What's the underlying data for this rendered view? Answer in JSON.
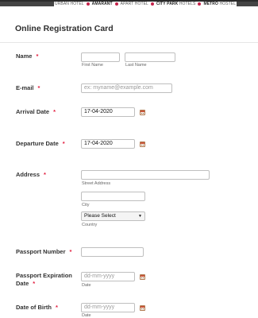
{
  "brand_bar": {
    "segments": [
      {
        "light": "URBAN HOTEL",
        "bold": ""
      },
      {
        "light": "",
        "bold": "AMARANT"
      },
      {
        "light": "APART HOTEL",
        "bold": ""
      },
      {
        "light": "",
        "bold": "CITY PARK",
        "light2": "HOTELS"
      },
      {
        "light": "",
        "bold": "METRO",
        "light2": "HOSTEL"
      }
    ]
  },
  "form": {
    "title": "Online Registration Card",
    "name": {
      "label": "Name",
      "required": "*",
      "first_sub": "First Name",
      "last_sub": "Last Name",
      "first_value": "",
      "last_value": ""
    },
    "email": {
      "label": "E-mail",
      "required": "*",
      "placeholder": "ex: myname@example.com"
    },
    "arrival": {
      "label": "Arrival Date",
      "required": "*",
      "value": "17-04-2020"
    },
    "departure": {
      "label": "Departure Date",
      "required": "*",
      "value": "17-04-2020"
    },
    "address": {
      "label": "Address",
      "required": "*",
      "street_sub": "Street Address",
      "city_sub": "City",
      "country_value": "Please Select",
      "country_sub": "Country"
    },
    "passport_number": {
      "label": "Passport Number",
      "required": "*"
    },
    "passport_expiration": {
      "label_line1": "Passport Expiration",
      "label_line2": "Date",
      "required": "*",
      "placeholder": "dd-mm-yyyy",
      "sub": "Date"
    },
    "dob": {
      "label": "Date of Birth",
      "required": "*",
      "placeholder": "dd-mm-yyyy",
      "sub": "Date"
    }
  },
  "icons": {
    "calendar": "calendar-icon",
    "select_caret": "caret-down-icon"
  },
  "colors": {
    "required_asterisk": "#e21b3c",
    "brand_dot": "#c4224a",
    "title": "#2e2e2e"
  }
}
